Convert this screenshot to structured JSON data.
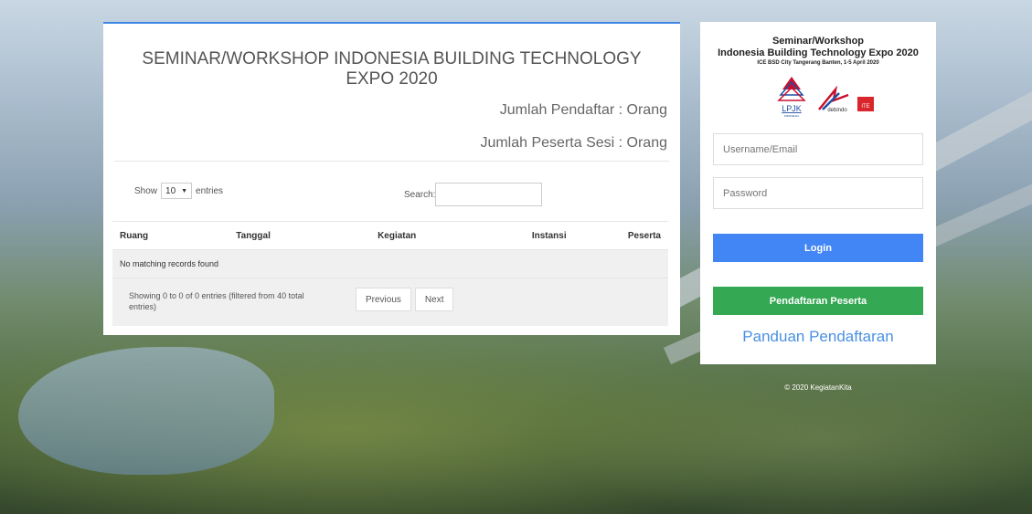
{
  "main": {
    "title": "SEMINAR/WORKSHOP INDONESIA BUILDING TECHNOLOGY EXPO 2020",
    "jumlah_pendaftar": "Jumlah Pendaftar : Orang",
    "jumlah_peserta": "Jumlah Peserta Sesi : Orang"
  },
  "table": {
    "show_label": "Show",
    "entries_value": "10",
    "entries_label": "entries",
    "search_label": "Search:",
    "columns": [
      "Ruang",
      "Tanggal",
      "Kegiatan",
      "Instansi",
      "Peserta"
    ],
    "empty_message": "No matching records found",
    "info": "Showing 0 to 0 of 0 entries (filtered from 40 total entries)",
    "previous": "Previous",
    "next": "Next"
  },
  "login": {
    "title_line1": "Seminar/Workshop",
    "title_line2": "Indonesia Building Technology Expo 2020",
    "title_line3": "ICE BSD City Tangerang Banten, 1-5 April 2020",
    "username_placeholder": "Username/Email",
    "password_placeholder": "Password",
    "login_button": "Login",
    "register_button": "Pendaftaran Peserta",
    "guide_link": "Panduan Pendaftaran",
    "logo_lpjk": "LPJK",
    "logo_lpjk_sub": "INDONESIA",
    "logo_debindo": "debindo",
    "logo_ite": "ITE"
  },
  "footer": {
    "copyright": "© 2020 KegiatanKita"
  },
  "colors": {
    "accent_blue": "#4285f4",
    "accent_green": "#34a853",
    "link_blue": "#4a90e2"
  }
}
